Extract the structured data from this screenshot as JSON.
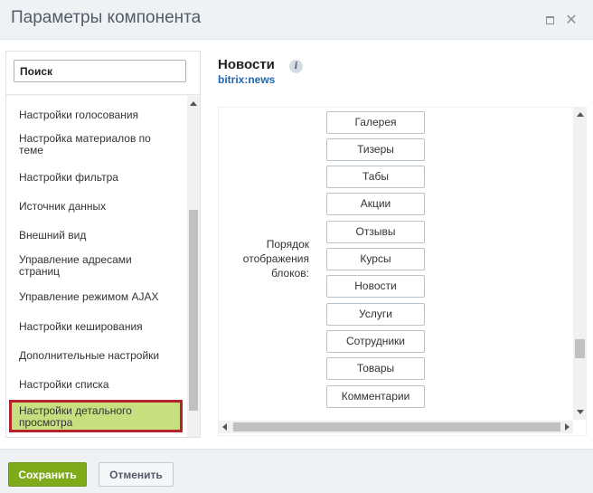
{
  "window": {
    "title": "Параметры компонента",
    "maximize_icon": "maximize-icon",
    "close_glyph": "✕"
  },
  "sidebar": {
    "search_placeholder": "Поиск",
    "items": [
      {
        "label": "Настройки голосования"
      },
      {
        "label": "Настройка материалов по теме"
      },
      {
        "label": "Настройки фильтра"
      },
      {
        "label": "Источник данных"
      },
      {
        "label": "Внешний вид"
      },
      {
        "label": "Управление адресами страниц"
      },
      {
        "label": "Управление режимом AJAX"
      },
      {
        "label": "Настройки кеширования"
      },
      {
        "label": "Дополнительные настройки"
      },
      {
        "label": "Настройки списка"
      },
      {
        "label": "Настройки детального просмотра",
        "active": true
      }
    ]
  },
  "component": {
    "name": "Новости",
    "code": "bitrix:news",
    "info_glyph": "i"
  },
  "order": {
    "label": "Порядок отображения блоков:",
    "buttons": [
      "Галерея",
      "Тизеры",
      "Табы",
      "Акции",
      "Отзывы",
      "Курсы",
      "Новости",
      "Услуги",
      "Сотрудники",
      "Товары",
      "Комментарии"
    ]
  },
  "footer": {
    "save_label": "Сохранить",
    "cancel_label": "Отменить"
  },
  "colors": {
    "save_button": "#7fab1b",
    "active_item_bg": "#c7df7f",
    "active_item_border": "#b3242a",
    "component_code": "#2067b0"
  }
}
